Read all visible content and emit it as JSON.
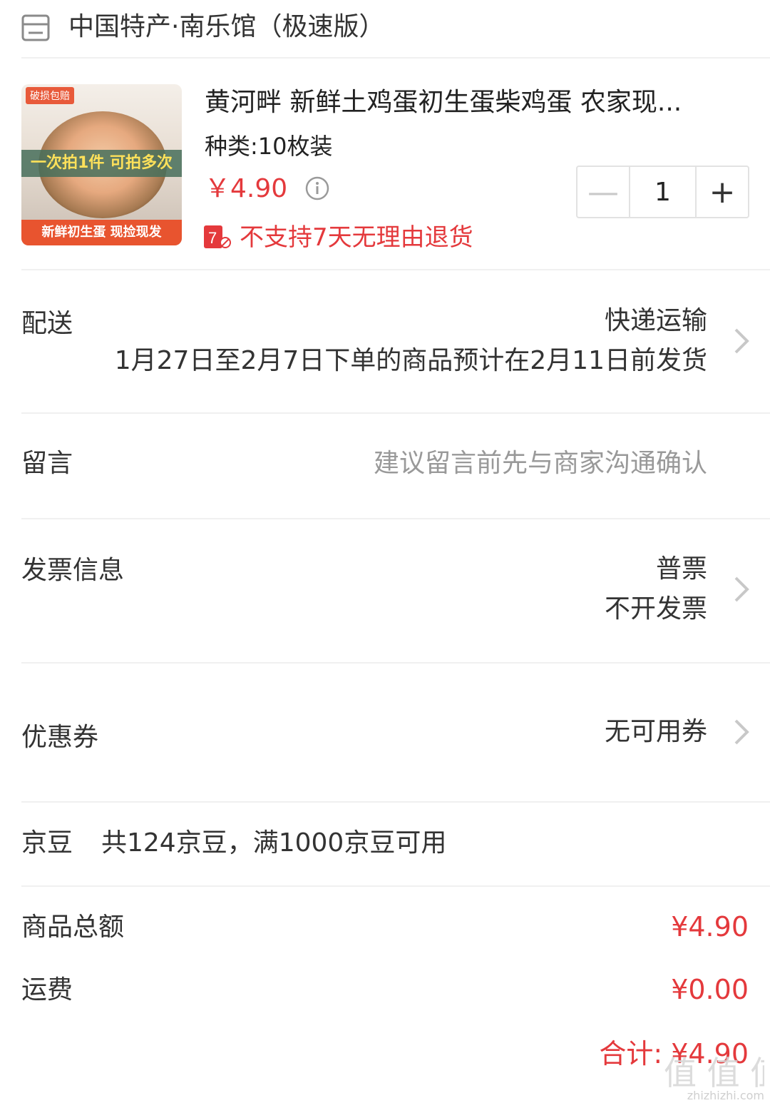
{
  "shop": {
    "name": "中国特产·南乐馆（极速版）",
    "icon": "store-icon"
  },
  "product": {
    "image": {
      "badge": "破损包赔",
      "middle_text": "一次拍1件 可拍多次",
      "bottom_text": "新鲜初生蛋 现捡现发"
    },
    "title": "黄河畔 新鲜土鸡蛋初生蛋柴鸡蛋 农家现...",
    "spec": "种类:10枚装",
    "price": "￥4.90",
    "return_policy": "不支持7天无理由退货",
    "return_icon_text": "7",
    "quantity": "1"
  },
  "delivery": {
    "label": "配送",
    "method": "快递运输",
    "estimate": "1月27日至2月7日下单的商品预计在2月11日前发货"
  },
  "message": {
    "label": "留言",
    "placeholder": "建议留言前先与商家沟通确认"
  },
  "invoice": {
    "label": "发票信息",
    "type": "普票",
    "status": "不开发票"
  },
  "coupon": {
    "label": "优惠券",
    "value": "无可用券"
  },
  "jingdou": {
    "label": "京豆",
    "desc": "共124京豆，满1000京豆可用"
  },
  "summary": {
    "goods_label": "商品总额",
    "goods_amount": "¥4.90",
    "shipping_label": "运费",
    "shipping_amount": "¥0.00",
    "total_text": "合计: ¥4.90"
  },
  "watermark": {
    "text": "值 值 值",
    "url_text": "zhizhizhi.com"
  },
  "colors": {
    "accent_red": "#e4393c",
    "divider": "#f0f0f0",
    "hint_gray": "#999999"
  }
}
